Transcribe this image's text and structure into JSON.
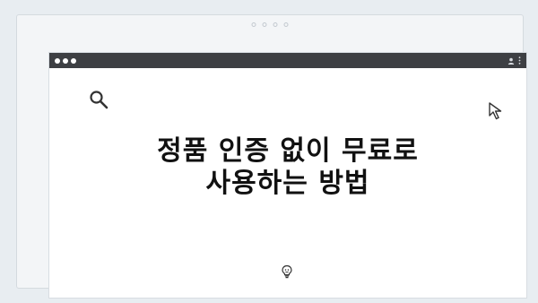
{
  "headline": {
    "line1": "정품 인증 없이 무료로",
    "line2": "사용하는 방법"
  },
  "icons": {
    "search": "search-icon",
    "cursor": "cursor-arrow-icon",
    "idea": "lightbulb-icon",
    "user": "user-avatar-icon",
    "menu": "more-vertical-icon"
  },
  "colors": {
    "page_background": "#e8edf1",
    "titlebar": "#3d3f43",
    "window_background": "#ffffff",
    "headline_text": "#111111"
  }
}
